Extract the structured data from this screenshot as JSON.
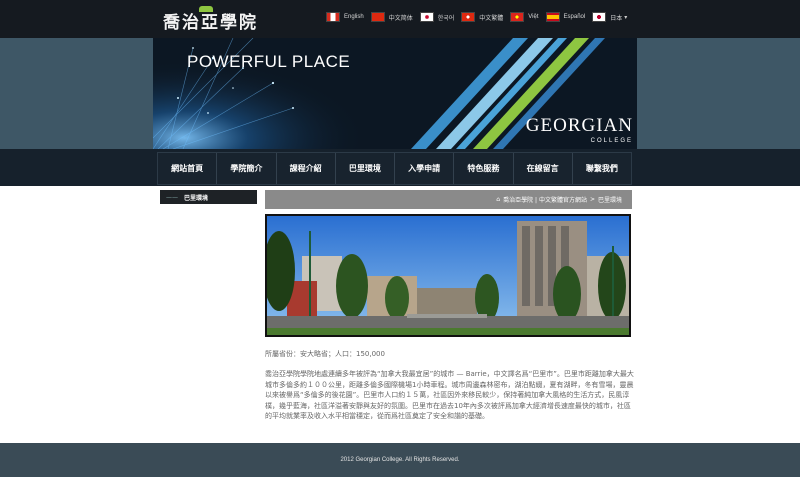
{
  "site": {
    "logo_text": "喬治亞學院"
  },
  "languages": [
    {
      "label": "English",
      "flag": "canada-flag-icon",
      "color": "#d52b1e"
    },
    {
      "label": "中文简体",
      "flag": "china-flag-icon",
      "color": "#de2910"
    },
    {
      "label": "한국어",
      "flag": "korea-flag-icon",
      "color": "#ffffff"
    },
    {
      "label": "中文繁體",
      "flag": "hongkong-flag-icon",
      "color": "#de2910"
    },
    {
      "label": "Việt",
      "flag": "vietnam-flag-icon",
      "color": "#da251d"
    },
    {
      "label": "Español",
      "flag": "spain-flag-icon",
      "color": "#c60b1e"
    },
    {
      "label": "日本",
      "flag": "japan-flag-icon",
      "color": "#ffffff"
    }
  ],
  "banner": {
    "title": "POWERFUL PLACE",
    "logo": "GEORGIAN",
    "logo_sub": "COLLEGE"
  },
  "nav": [
    "網站首頁",
    "學院簡介",
    "課程介紹",
    "巴里環境",
    "入學申請",
    "特色服務",
    "在線留言",
    "聯繫我們"
  ],
  "sidebar": {
    "item": "巴里環境"
  },
  "breadcrumb": [
    "喬治亞學院 | 中文繁體官方網站",
    "巴里環境"
  ],
  "content": {
    "meta": "所屬省份：安大略省；人口：150,000",
    "paragraph": "喬治亞學院學院地處連續多年被評為“加拿大我最宜居”的城市 — Barrie，中文譯名爲“巴里市”。巴里市距離加拿大最大城市多倫多約１００公里，距離多倫多國際機場1小時車程。城市周邊森林密布，湖泊點綴，夏有湖畔，冬有雪場，靈晨以來被譽爲“多倫多的後花園”。巴里市人口約１５萬，社區因外來移民較少，保持著純加拿大風格的生活方式，民風淳樸，幾乎藍海，社區洋溢著安靜與友好的氛圍。巴里市在過去10年內多次被評爲加拿大經濟增長速度最快的城市，社區的平均就業率及收入水平相當穩定，從而爲社區奠定了安全和諧的基礎。"
  },
  "footer": {
    "text": "2012 Georgian College. All Rights Reserved."
  },
  "colors": {
    "topbar": "#151a20",
    "band": "#3e5766",
    "nav": "#18232e",
    "footer": "#3a4b56",
    "accent_green": "#8ec641",
    "accent_blue": "#4aa3d8"
  }
}
